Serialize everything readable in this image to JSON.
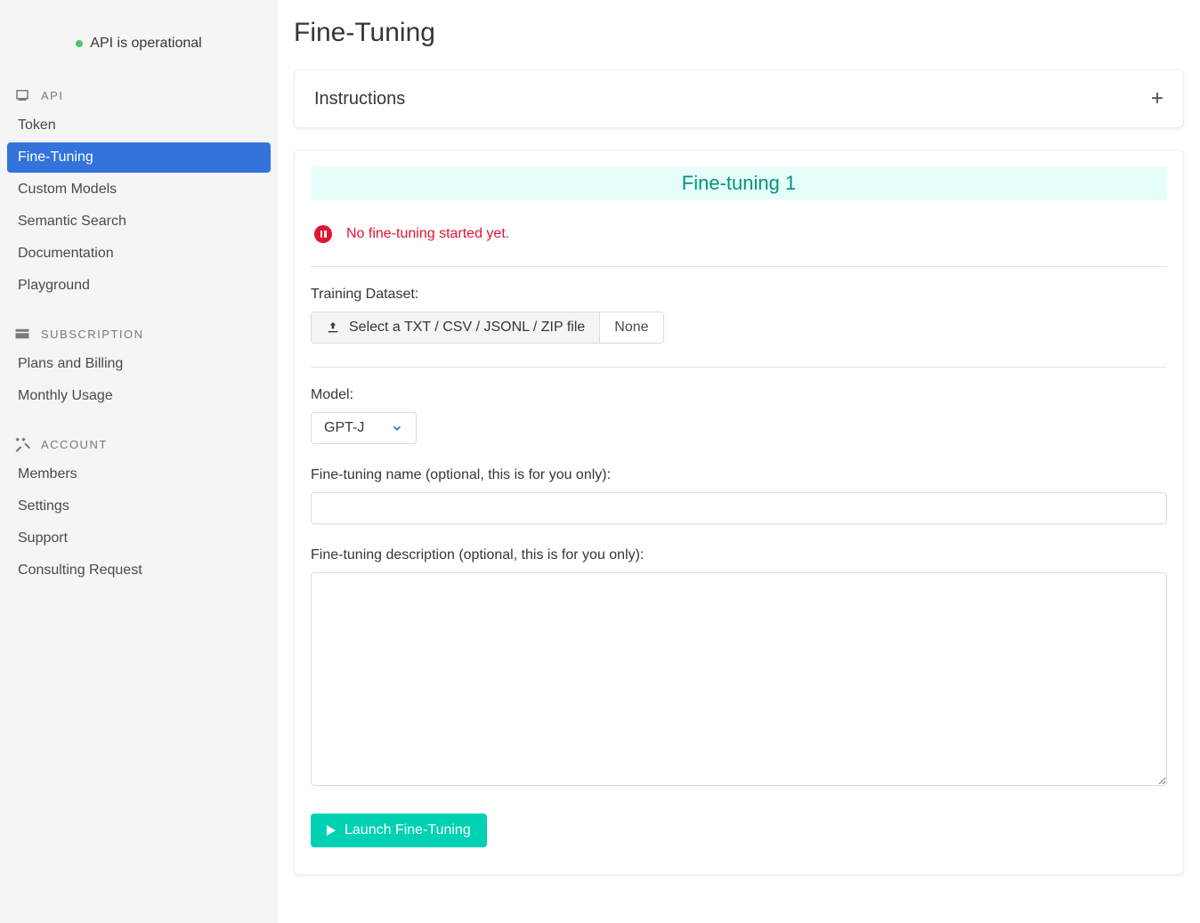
{
  "status": {
    "text": "API is operational"
  },
  "sidebar": {
    "sections": [
      {
        "title": "API",
        "items": [
          {
            "label": "Token",
            "active": false
          },
          {
            "label": "Fine-Tuning",
            "active": true
          },
          {
            "label": "Custom Models",
            "active": false
          },
          {
            "label": "Semantic Search",
            "active": false
          },
          {
            "label": "Documentation",
            "active": false
          },
          {
            "label": "Playground",
            "active": false
          }
        ]
      },
      {
        "title": "SUBSCRIPTION",
        "items": [
          {
            "label": "Plans and Billing",
            "active": false
          },
          {
            "label": "Monthly Usage",
            "active": false
          }
        ]
      },
      {
        "title": "ACCOUNT",
        "items": [
          {
            "label": "Members",
            "active": false
          },
          {
            "label": "Settings",
            "active": false
          },
          {
            "label": "Support",
            "active": false
          },
          {
            "label": "Consulting Request",
            "active": false
          }
        ]
      }
    ]
  },
  "page": {
    "title": "Fine-Tuning"
  },
  "instructions": {
    "header": "Instructions"
  },
  "finetune": {
    "banner": "Fine-tuning 1",
    "status_message": "No fine-tuning started yet.",
    "dataset_label": "Training Dataset:",
    "dataset_button": "Select a TXT / CSV / JSONL / ZIP file",
    "dataset_filename": "None",
    "model_label": "Model:",
    "model_selected": "GPT-J",
    "name_label": "Fine-tuning name (optional, this is for you only):",
    "name_value": "",
    "desc_label": "Fine-tuning description (optional, this is for you only):",
    "desc_value": "",
    "launch_label": "Launch Fine-Tuning"
  }
}
